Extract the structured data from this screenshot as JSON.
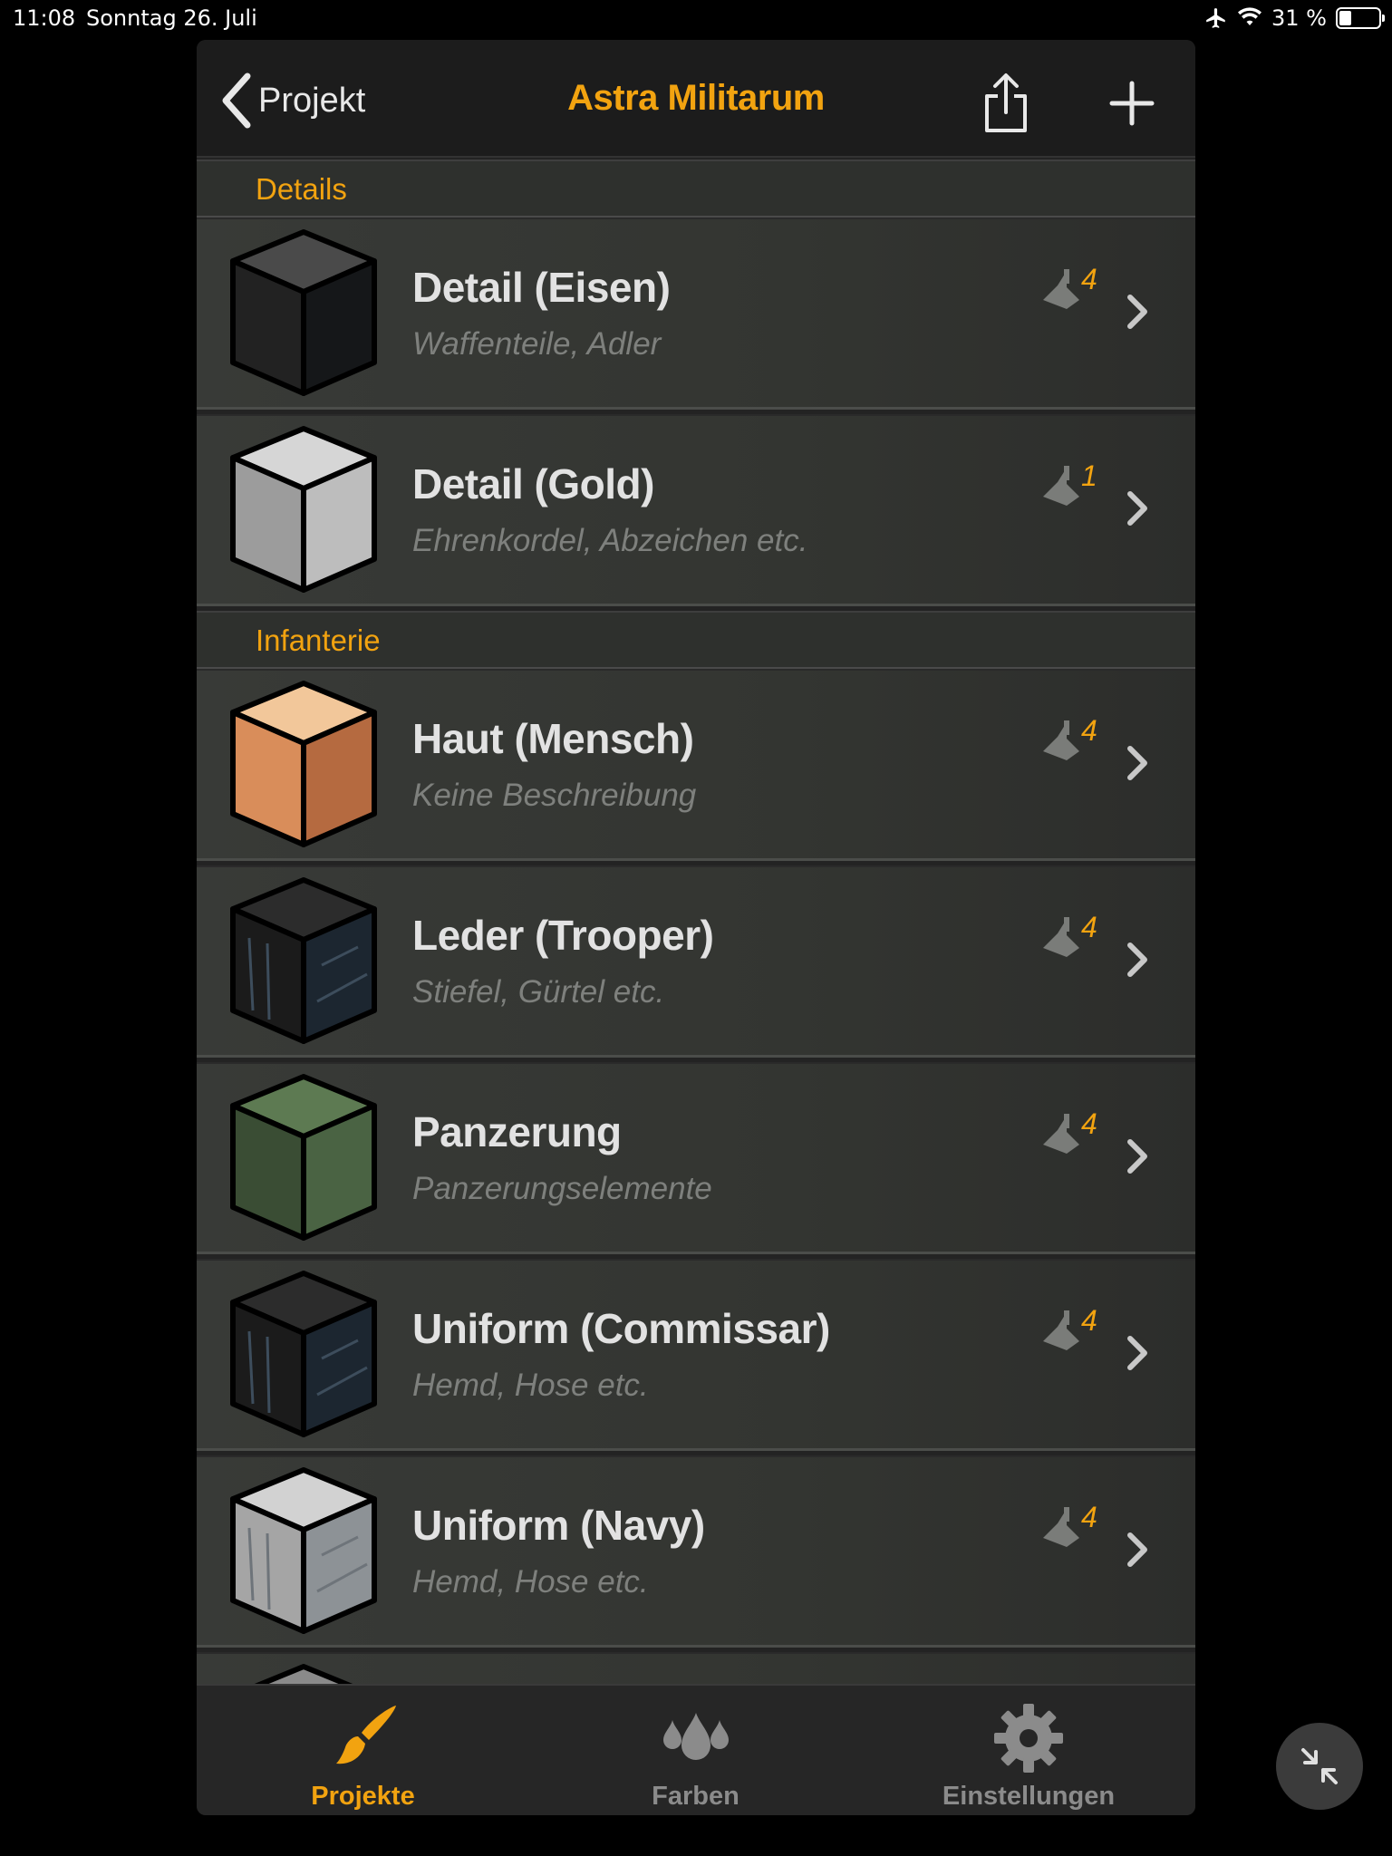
{
  "status_bar": {
    "time": "11:08",
    "date": "Sonntag 26. Juli",
    "battery": "31 %"
  },
  "nav": {
    "back_label": "Projekt",
    "title": "Astra Militarum"
  },
  "sections": [
    {
      "title": "Details",
      "items": [
        {
          "name": "Detail (Eisen)",
          "desc": "Waffenteile, Adler",
          "count": "4",
          "swatch": "dark-metal"
        },
        {
          "name": "Detail (Gold)",
          "desc": "Ehrenkordel, Abzeichen etc.",
          "count": "1",
          "swatch": "silver"
        }
      ]
    },
    {
      "title": "Infanterie",
      "items": [
        {
          "name": "Haut (Mensch)",
          "desc": "Keine Beschreibung",
          "count": "4",
          "swatch": "skin"
        },
        {
          "name": "Leder (Trooper)",
          "desc": "Stiefel, Gürtel etc.",
          "count": "4",
          "swatch": "black-cloth"
        },
        {
          "name": "Panzerung",
          "desc": "Panzerungselemente",
          "count": "4",
          "swatch": "green"
        },
        {
          "name": "Uniform (Commissar)",
          "desc": "Hemd, Hose etc.",
          "count": "4",
          "swatch": "black-cloth"
        },
        {
          "name": "Uniform (Navy)",
          "desc": "Hemd, Hose etc.",
          "count": "4",
          "swatch": "grey-cloth"
        }
      ]
    }
  ],
  "tabs": [
    {
      "label": "Projekte",
      "icon": "brush-icon",
      "active": true
    },
    {
      "label": "Farben",
      "icon": "drops-icon",
      "active": false
    },
    {
      "label": "Einstellungen",
      "icon": "gear-icon",
      "active": false
    }
  ],
  "colors": {
    "accent": "#f2a310",
    "background": "#232323",
    "row": "#383a37"
  }
}
